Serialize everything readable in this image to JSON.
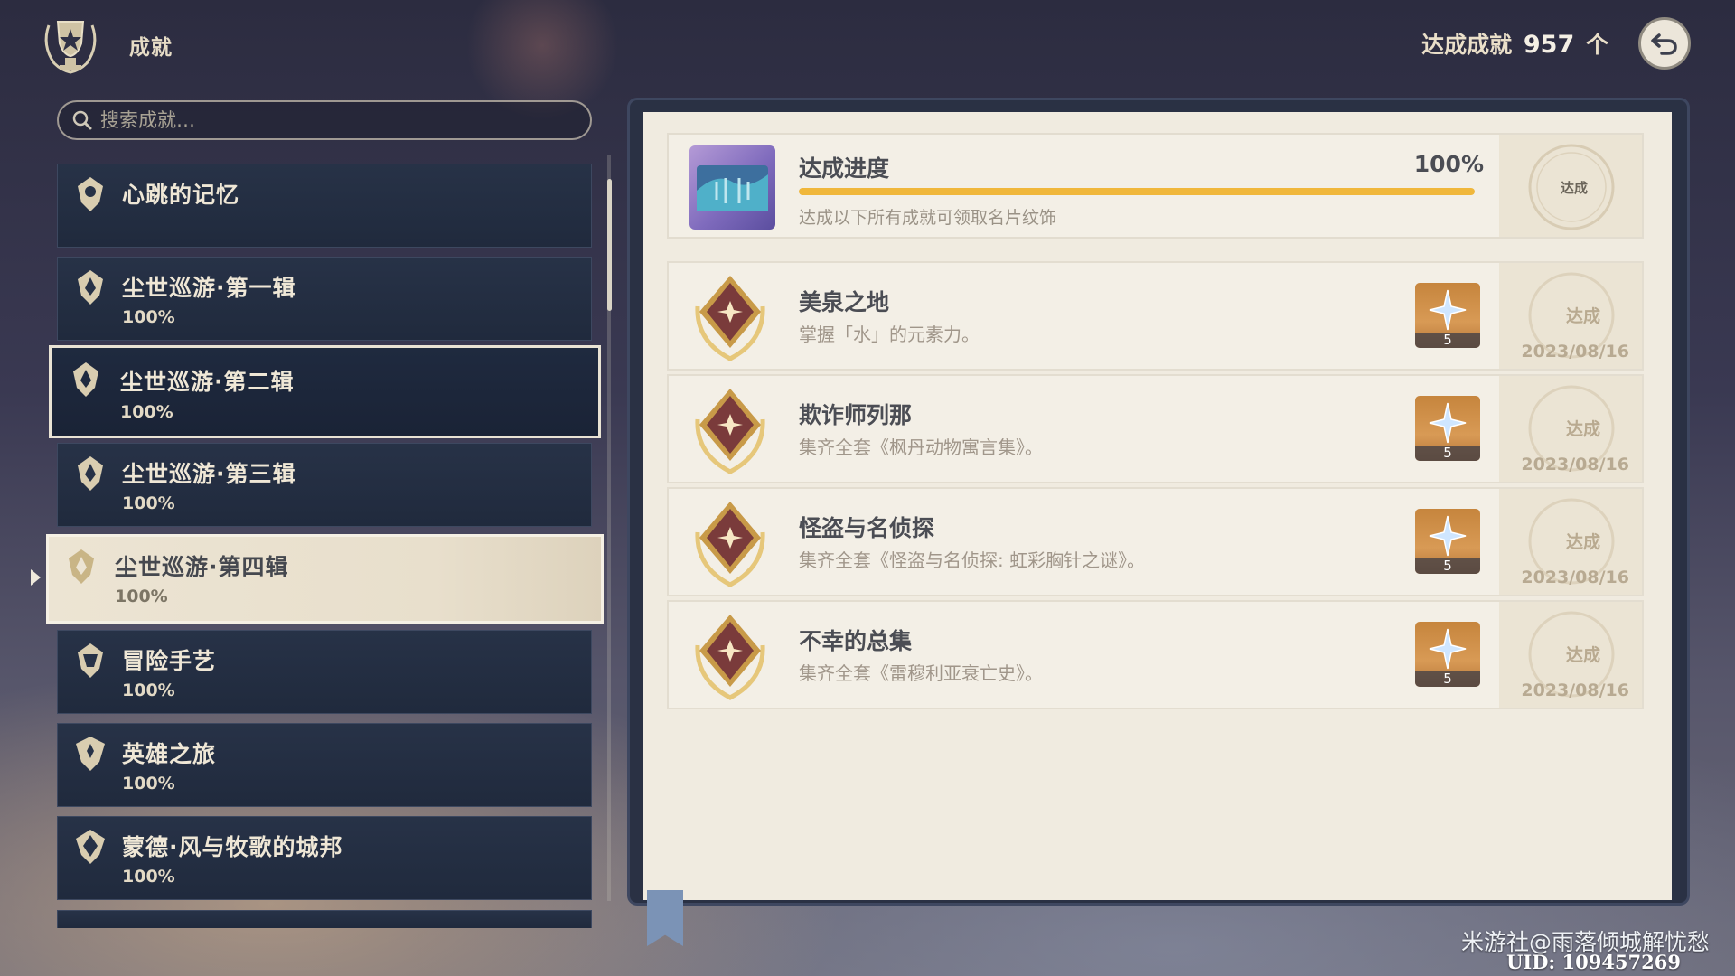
{
  "header": {
    "title": "成就",
    "total_label": "达成成就",
    "total_count": "957",
    "total_unit": "个"
  },
  "search": {
    "placeholder": "搜索成就…"
  },
  "categories": [
    {
      "name": "心跳的记忆",
      "pct": ""
    },
    {
      "name": "尘世巡游·第一辑",
      "pct": "100%"
    },
    {
      "name": "尘世巡游·第二辑",
      "pct": "100%"
    },
    {
      "name": "尘世巡游·第三辑",
      "pct": "100%"
    },
    {
      "name": "尘世巡游·第四辑",
      "pct": "100%"
    },
    {
      "name": "冒险手艺",
      "pct": "100%"
    },
    {
      "name": "英雄之旅",
      "pct": "100%"
    },
    {
      "name": "蒙德·风与牧歌的城邦",
      "pct": "100%"
    }
  ],
  "progress": {
    "title": "达成进度",
    "percent_text": "100%",
    "percent_value": 100,
    "description": "达成以下所有成就可领取名片纹饰",
    "stamp": "达成"
  },
  "achievements": [
    {
      "name": "美泉之地",
      "desc": "掌握「水」的元素力。",
      "reward": "5",
      "stamp": "达成",
      "date": "2023/08/16"
    },
    {
      "name": "欺诈师列那",
      "desc": "集齐全套《枫丹动物寓言集》。",
      "reward": "5",
      "stamp": "达成",
      "date": "2023/08/16"
    },
    {
      "name": "怪盗与名侦探",
      "desc": "集齐全套《怪盗与名侦探: 虹彩胸针之谜》。",
      "reward": "5",
      "stamp": "达成",
      "date": "2023/08/16"
    },
    {
      "name": "不幸的总集",
      "desc": "集齐全套《雷穆利亚衰亡史》。",
      "reward": "5",
      "stamp": "达成",
      "date": "2023/08/16"
    }
  ],
  "watermark": "米游社@雨落倾城解忧愁",
  "uid": "UID: 109457269"
}
